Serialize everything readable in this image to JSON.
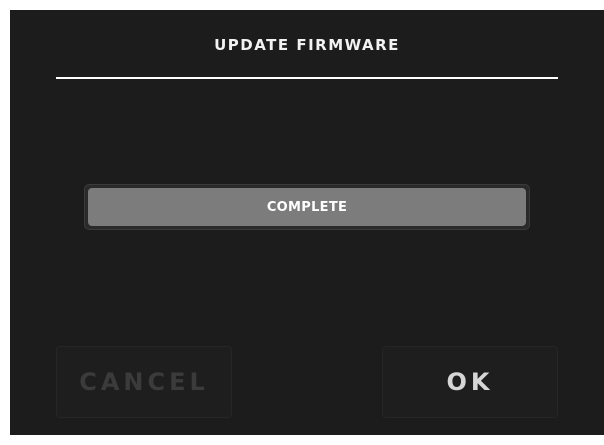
{
  "dialog": {
    "title": "UPDATE FIRMWARE",
    "progress": {
      "label": "COMPLETE",
      "value_percent": 100
    },
    "buttons": {
      "cancel_label": "CANCEL",
      "cancel_enabled": false,
      "ok_label": "OK",
      "ok_enabled": true
    }
  },
  "colors": {
    "dialog_background": "#1c1c1c",
    "progress_fill": "#7c7c7c",
    "title_rule": "#ffffff",
    "disabled_text": "#3b3b3b",
    "enabled_text": "#d6d6d6"
  }
}
